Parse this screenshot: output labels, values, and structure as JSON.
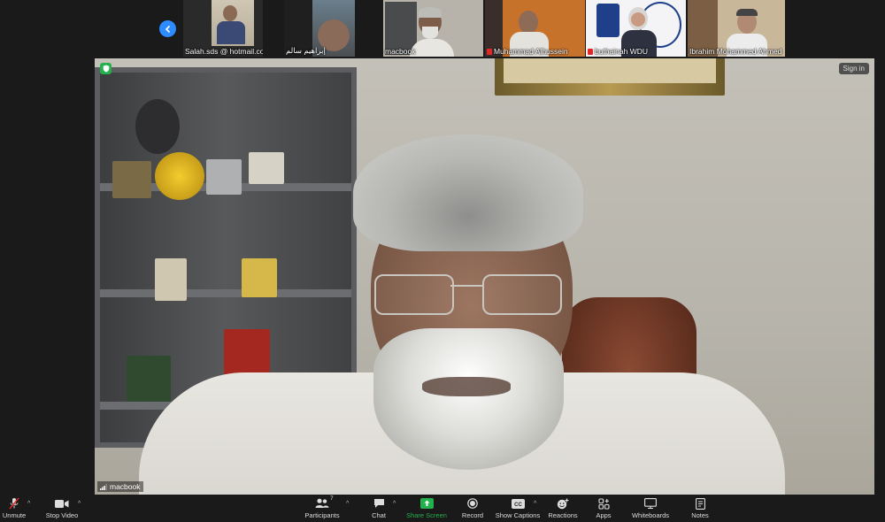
{
  "participants": [
    {
      "name": "Salah.sds @ hotmail.com",
      "muted": false,
      "rtl": false
    },
    {
      "name": "إبراهيم سالم",
      "muted": false,
      "rtl": true
    },
    {
      "name": "macbook",
      "muted": false,
      "rtl": false,
      "active": true
    },
    {
      "name": "Muhammad Alhussein",
      "muted": true,
      "rtl": false
    },
    {
      "name": "buthainah WDU",
      "muted": true,
      "rtl": false
    },
    {
      "name": "Ibrahim Mohammed Ahmed",
      "muted": false,
      "rtl": false
    }
  ],
  "main_video": {
    "speaker_name": "macbook",
    "sign_in_label": "Sign in"
  },
  "toolbar": {
    "unmute": "Unmute",
    "stop_video": "Stop Video",
    "participants": "Participants",
    "participants_count": "7",
    "chat": "Chat",
    "share_screen": "Share Screen",
    "record": "Record",
    "show_captions": "Show Captions",
    "reactions": "Reactions",
    "apps": "Apps",
    "whiteboards": "Whiteboards",
    "notes": "Notes"
  },
  "colors": {
    "background": "#1a1a1a",
    "accent_blue": "#2d8cff",
    "share_green": "#23b14d",
    "active_speaker": "#9dd234",
    "muted_red": "#e02828"
  }
}
